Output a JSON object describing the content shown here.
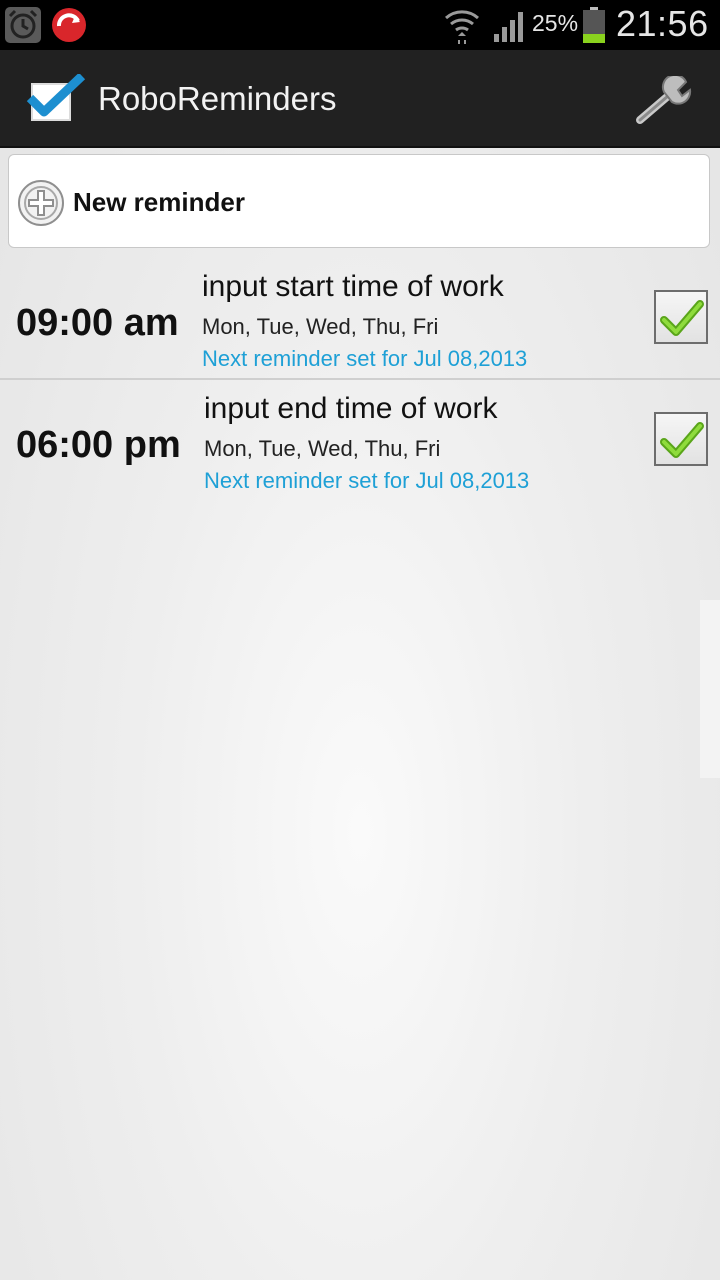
{
  "status_bar": {
    "battery_percent": "25%",
    "time": "21:56",
    "icons": [
      "alarm-icon",
      "trend-micro-icon",
      "wifi-icon",
      "signal-icon",
      "battery-icon"
    ]
  },
  "action_bar": {
    "title": "RoboReminders",
    "icons": [
      "app-checkbox-icon",
      "wrench-icon"
    ]
  },
  "new_reminder": {
    "label": "New reminder",
    "icon": "plus-circle-icon"
  },
  "reminders": [
    {
      "time": "09:00 am",
      "title": "input start time of work",
      "days": "Mon, Tue, Wed, Thu, Fri",
      "next": "Next reminder set for Jul 08,2013",
      "enabled": true
    },
    {
      "time": "06:00 pm",
      "title": "input end time of work",
      "days": "Mon, Tue, Wed, Thu, Fri",
      "next": "Next reminder set for Jul 08,2013",
      "enabled": true
    }
  ],
  "colors": {
    "accent_link": "#1ea0d6",
    "checkmark_green": "#7ccc2e",
    "app_icon_blue": "#1d8fd0",
    "action_bar": "#212121"
  }
}
